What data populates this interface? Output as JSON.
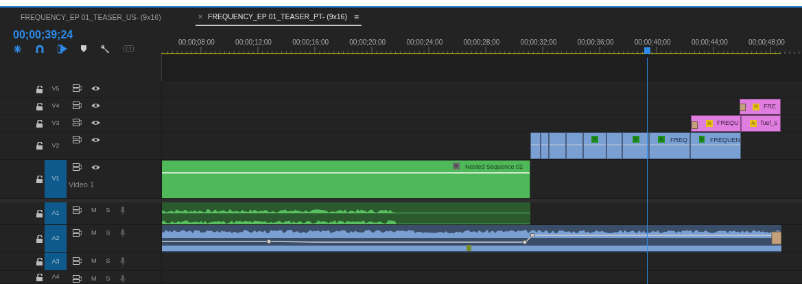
{
  "tabs": [
    {
      "label": "FREQUENCY_EP 01_TEASER_US- (9x16)",
      "selected": false
    },
    {
      "label": "FREQUENCY_EP 01_TEASER_PT- (9x16)",
      "selected": true,
      "close": "×",
      "menu": "≡"
    }
  ],
  "timecode": "00;00;39;24",
  "ruler": [
    "00;00;08;00",
    "00;00;12;00",
    "00;00;16;00",
    "00;00;20;00",
    "00;00;24;00",
    "00;00;28;00",
    "00;00;32;00",
    "00;00;36;00",
    "00;00;40;00",
    "00;00;44;00",
    "00;00;48;00"
  ],
  "video_tracks": [
    {
      "label": "V5",
      "targeted": false
    },
    {
      "label": "V4",
      "targeted": false
    },
    {
      "label": "V3",
      "targeted": false
    },
    {
      "label": "V2",
      "targeted": false
    },
    {
      "label": "V1",
      "targeted": true,
      "name": "Video 1"
    }
  ],
  "audio_tracks": [
    {
      "label": "A1",
      "targeted": true,
      "mute": "M",
      "solo": "S"
    },
    {
      "label": "A2",
      "targeted": true,
      "mute": "M",
      "solo": "S"
    },
    {
      "label": "A3",
      "targeted": true,
      "mute": "M",
      "solo": "S"
    },
    {
      "label": "A4",
      "targeted": false,
      "mute": "M",
      "solo": "S"
    }
  ],
  "clips": {
    "v4": [
      {
        "badge": "fx",
        "label": "FRE"
      }
    ],
    "v3": [
      {
        "badge": "fx",
        "label": "FREQU"
      },
      {
        "badge": "fx",
        "label": "fuel_s"
      }
    ],
    "v2": [
      {
        "kind": "plain"
      },
      {
        "kind": "plain"
      },
      {
        "kind": "plain"
      },
      {
        "kind": "plain"
      },
      {
        "kind": "effect",
        "badge": "fx"
      },
      {
        "kind": "plain"
      },
      {
        "kind": "effect",
        "badge": "fx"
      },
      {
        "kind": "effect",
        "badge": "fx",
        "label": "FREQ"
      },
      {
        "kind": "effect",
        "badge": "fx",
        "label": "FREQUEN"
      }
    ],
    "v1": {
      "badge": "fx",
      "label": "Nested Sequence 02"
    }
  }
}
